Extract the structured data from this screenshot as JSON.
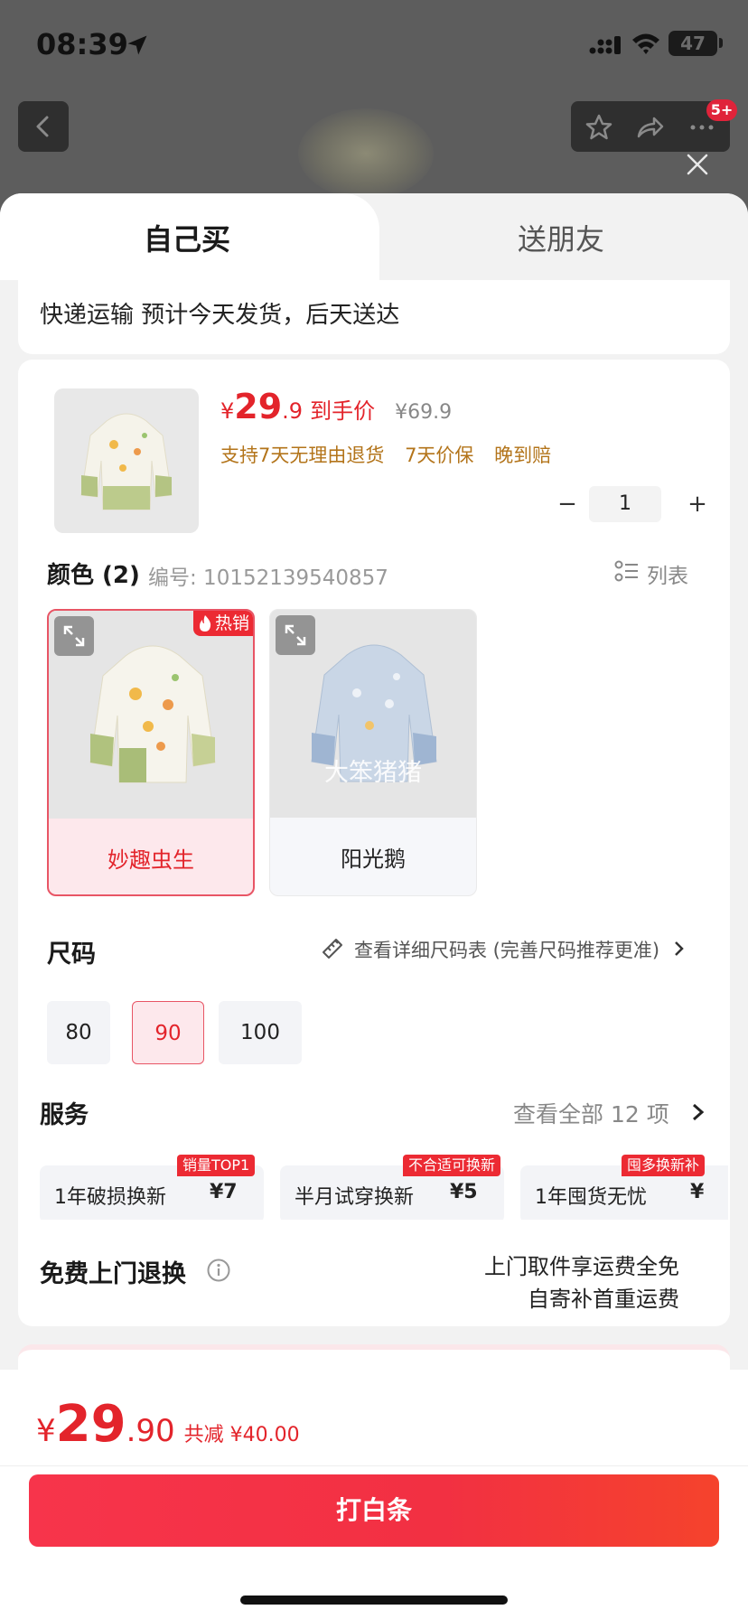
{
  "status_bar": {
    "time": "08:39",
    "battery": "47"
  },
  "nav": {
    "badge": "5+"
  },
  "tabs": [
    {
      "label": "自己买"
    },
    {
      "label": "送朋友"
    }
  ],
  "shipping": {
    "text": "快递运输 预计今天发货，后天送达"
  },
  "product": {
    "price_currency": "¥",
    "price_integer": "29",
    "price_decimal": ".9",
    "price_tag": "到手价",
    "original_price": "¥69.9",
    "promises": [
      "支持7天无理由退货",
      "7天价保",
      "晚到赔"
    ],
    "quantity": "1"
  },
  "color_section": {
    "title": "颜色 (2)",
    "sku": "编号: 10152139540857",
    "list_label": "列表",
    "variants": [
      {
        "label": "妙趣虫生",
        "hot_tag": "热销",
        "selected": true
      },
      {
        "label": "阳光鹅",
        "watermark": "大笨猪猪",
        "selected": false
      }
    ]
  },
  "size_section": {
    "title": "尺码",
    "chart_link": "查看详细尺码表 (完善尺码推荐更准)",
    "options": [
      {
        "label": "80",
        "selected": false
      },
      {
        "label": "90",
        "selected": true
      },
      {
        "label": "100",
        "selected": false
      }
    ]
  },
  "services": {
    "title": "服务",
    "view_all_prefix": "查看全部",
    "view_all_count": "12",
    "view_all_suffix": "项",
    "items": [
      {
        "name": "1年破损换新",
        "price": "¥7",
        "tag": "销量TOP1"
      },
      {
        "name": "半月试穿换新",
        "price": "¥5",
        "tag": "不合适可换新"
      },
      {
        "name": "1年囤货无忧",
        "price": "¥",
        "tag": "囤多换新补"
      }
    ]
  },
  "free_return": {
    "title": "免费上门退换",
    "line1": "上门取件享运费全免",
    "line2": "自寄补首重运费"
  },
  "bottom": {
    "currency": "¥",
    "integer": "29",
    "decimal": ".90",
    "saving": "共减 ¥40.00",
    "button": "打白条"
  },
  "colors": {
    "accent": "#e3242b",
    "promise": "#b3741a",
    "button": "#f2303f"
  }
}
